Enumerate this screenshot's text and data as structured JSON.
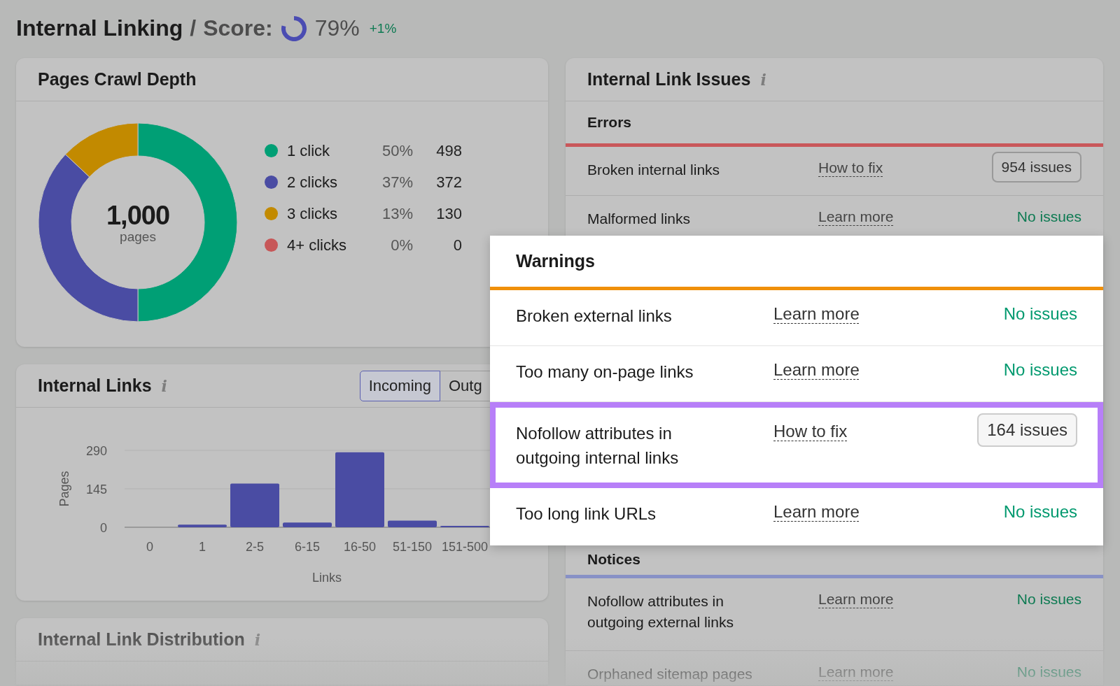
{
  "header": {
    "title": "Internal Linking",
    "separator": "/",
    "score_label": "Score:",
    "score": {
      "value": "79%"
    },
    "change": "+1%"
  },
  "crawl_depth": {
    "title": "Pages Crawl Depth",
    "total": "1,000",
    "total_label": "pages",
    "legend": [
      {
        "percent": "50%",
        "count": "498",
        "color": "#009f75"
      },
      {
        "percent": "37%",
        "count": "372",
        "color": "#4a4ca3"
      },
      {
        "percent": "13%",
        "count": "130",
        "color": "#c28a00"
      },
      {
        "percent": "0%",
        "count": "0",
        "color": "#c75758"
      }
    ],
    "chart_data": {
      "type": "donut",
      "categories": [
        "1 click",
        "2 clicks",
        "3 clicks",
        "4+ clicks"
      ],
      "values": [
        50,
        37,
        13,
        0
      ]
    }
  },
  "internal_links": {
    "title": "Internal Links",
    "info": "i",
    "tabs": [
      {
        "label": "Incoming",
        "selected": true
      },
      {
        "label": "Outg",
        "selected": false
      }
    ],
    "chart_data": {
      "type": "bar",
      "xlabel": "Links",
      "ylabel": "Pages",
      "categories": [
        "0",
        "1",
        "2-5",
        "6-15",
        "16-50",
        "51-150",
        "151-500"
      ],
      "values": [
        0,
        10,
        165,
        18,
        283,
        25,
        5
      ],
      "ylim": [
        0,
        290
      ],
      "yticks": [
        0,
        145,
        290
      ]
    }
  },
  "link_distribution": {
    "title": "Internal Link Distribution",
    "info": "i"
  },
  "issues": {
    "title": "Internal Link Issues",
    "info": "i",
    "groups": [
      {
        "title": "Errors",
        "color": "#c9575a",
        "rows": [
          {
            "name": "Broken internal links",
            "link": "How to fix",
            "status": "954 issues",
            "kind": "count"
          },
          {
            "name": "Malformed links",
            "link": "Learn more",
            "status": "No issues",
            "kind": "none"
          }
        ]
      },
      {
        "title": "Notices",
        "color": "#8891c6",
        "rows": [
          {
            "name": "Nofollow attributes in outgoing external links",
            "link": "Learn more",
            "status": "No issues",
            "kind": "none"
          },
          {
            "name": "Orphaned sitemap pages",
            "link": "Learn more",
            "status": "No issues",
            "kind": "none"
          }
        ]
      }
    ]
  },
  "popup": {
    "title": "Warnings",
    "color": "#f0900a",
    "rows": [
      {
        "name": "Broken external links",
        "link": "Learn more",
        "status": "No issues",
        "kind": "none",
        "highlighted": false
      },
      {
        "name": "Too many on-page links",
        "link": "Learn more",
        "status": "No issues",
        "kind": "none",
        "highlighted": false
      },
      {
        "name": "Nofollow attributes in outgoing internal links",
        "link": "How to fix",
        "status": "164 issues",
        "kind": "count",
        "highlighted": true
      },
      {
        "name": "Too long link URLs",
        "link": "Learn more",
        "status": "No issues",
        "kind": "none",
        "highlighted": false
      }
    ]
  }
}
